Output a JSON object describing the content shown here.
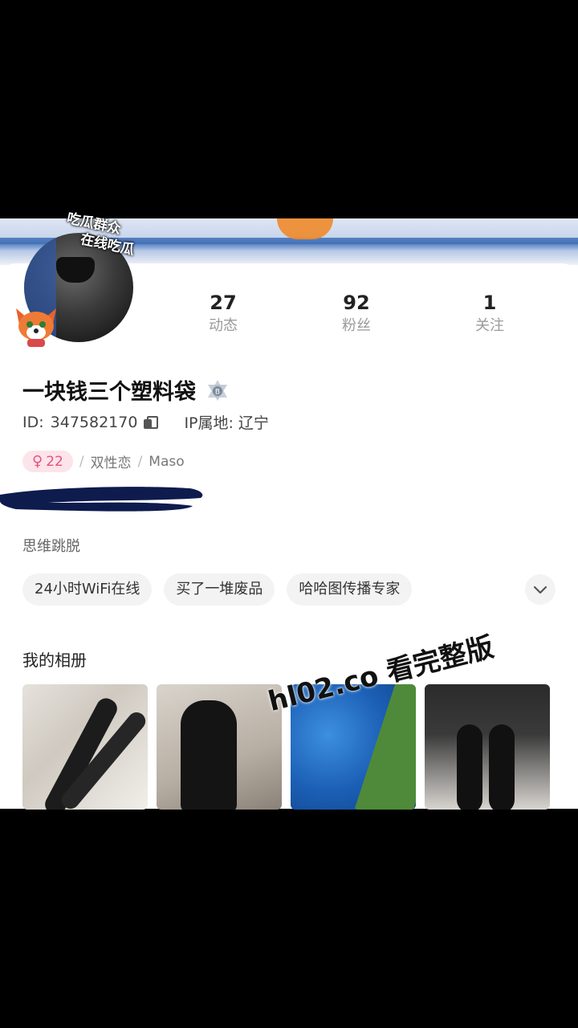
{
  "profile": {
    "avatar_sticker_line1": "吃瓜群众",
    "avatar_sticker_line2": "在线吃瓜",
    "name": "一块钱三个塑料袋",
    "id_label": "ID:",
    "id_value": "347582170",
    "ip_label": "IP属地:",
    "ip_value": "辽宁",
    "gender_symbol": "♀",
    "age": "22",
    "orientation": "双性恋",
    "role": "Maso",
    "separator": "/",
    "motto": "思维跳脱"
  },
  "stats": [
    {
      "value": "27",
      "label": "动态"
    },
    {
      "value": "92",
      "label": "粉丝"
    },
    {
      "value": "1",
      "label": "关注"
    }
  ],
  "chips": [
    "24小时WiFi在线",
    "买了一堆废品",
    "哈哈图传播专家"
  ],
  "album": {
    "title": "我的相册"
  },
  "watermark": "hl02.co 看完整版",
  "colors": {
    "gender_bg": "#fde3ea",
    "gender_fg": "#e05580",
    "redaction": "#0e1b4d"
  }
}
